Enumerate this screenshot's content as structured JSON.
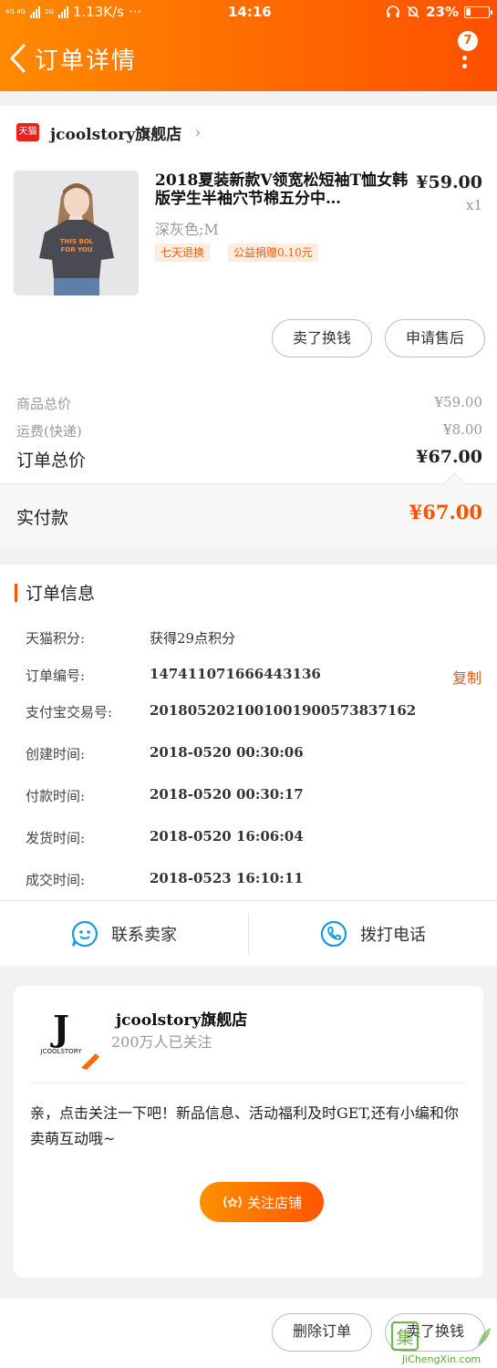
{
  "status_bar": {
    "signal_text": "4G 4G",
    "net_type": "2G",
    "speed": "1.13K/s",
    "dots": "···",
    "time": "14:16",
    "battery": "23%"
  },
  "header": {
    "title": "订单详情",
    "badge_count": "7"
  },
  "shop": {
    "logo_text": "天猫",
    "name": "jcoolstory旗舰店"
  },
  "product": {
    "title": "2018夏装新款V领宽松短袖T恤女韩版学生半袖穴节棉五分中…",
    "price": "¥59.00",
    "qty": "x1",
    "sku": "深灰色;M",
    "tags": [
      "七天退换",
      "公益捐赠0.10元"
    ],
    "shirt_print": [
      "THIS BOL",
      "FOR YOU"
    ]
  },
  "actions": {
    "resell_label": "卖了换钱",
    "aftersale_label": "申请售后",
    "delete_label": "删除订单"
  },
  "fees": {
    "goods_label": "商品总价",
    "goods_value": "¥59.00",
    "shipping_label": "运费(快递)",
    "shipping_value": "¥8.00",
    "total_label": "订单总价",
    "total_value": "¥67.00",
    "paid_label": "实付款",
    "paid_value": "¥67.00"
  },
  "order_info": {
    "section_title": "订单信息",
    "copy_label": "复制",
    "rows": [
      {
        "label": "天猫积分:",
        "value": "获得29点积分"
      },
      {
        "label": "订单编号:",
        "value": "147411071666443136"
      },
      {
        "label": "支付宝交易号:",
        "value": "2018052021001001900573837162"
      },
      {
        "label": "创建时间:",
        "value": "2018-0520 00:30:06"
      },
      {
        "label": "付款时间:",
        "value": "2018-0520 00:30:17"
      },
      {
        "label": "发货时间:",
        "value": "2018-0520 16:06:04"
      },
      {
        "label": "成交时间:",
        "value": "2018-0523 16:10:11"
      }
    ],
    "contact_seller": "联系卖家",
    "call_phone": "拨打电话"
  },
  "follow_card": {
    "brand_letter": "J",
    "brand_logo_text": "JCOOLSTORY",
    "name": "jcoolstory旗舰店",
    "followers": "200万人已关注",
    "message": "亲，点击关注一下吧！新品信息、活动福利及时GET,还有小编和你卖萌互动哦~",
    "follow_button": "关注店铺"
  },
  "watermark": {
    "mark": "集",
    "site": "JiChengXin.com"
  },
  "colors": {
    "accent": "#ff5000",
    "header_start": "#ff8a00",
    "header_end": "#ff5000"
  }
}
